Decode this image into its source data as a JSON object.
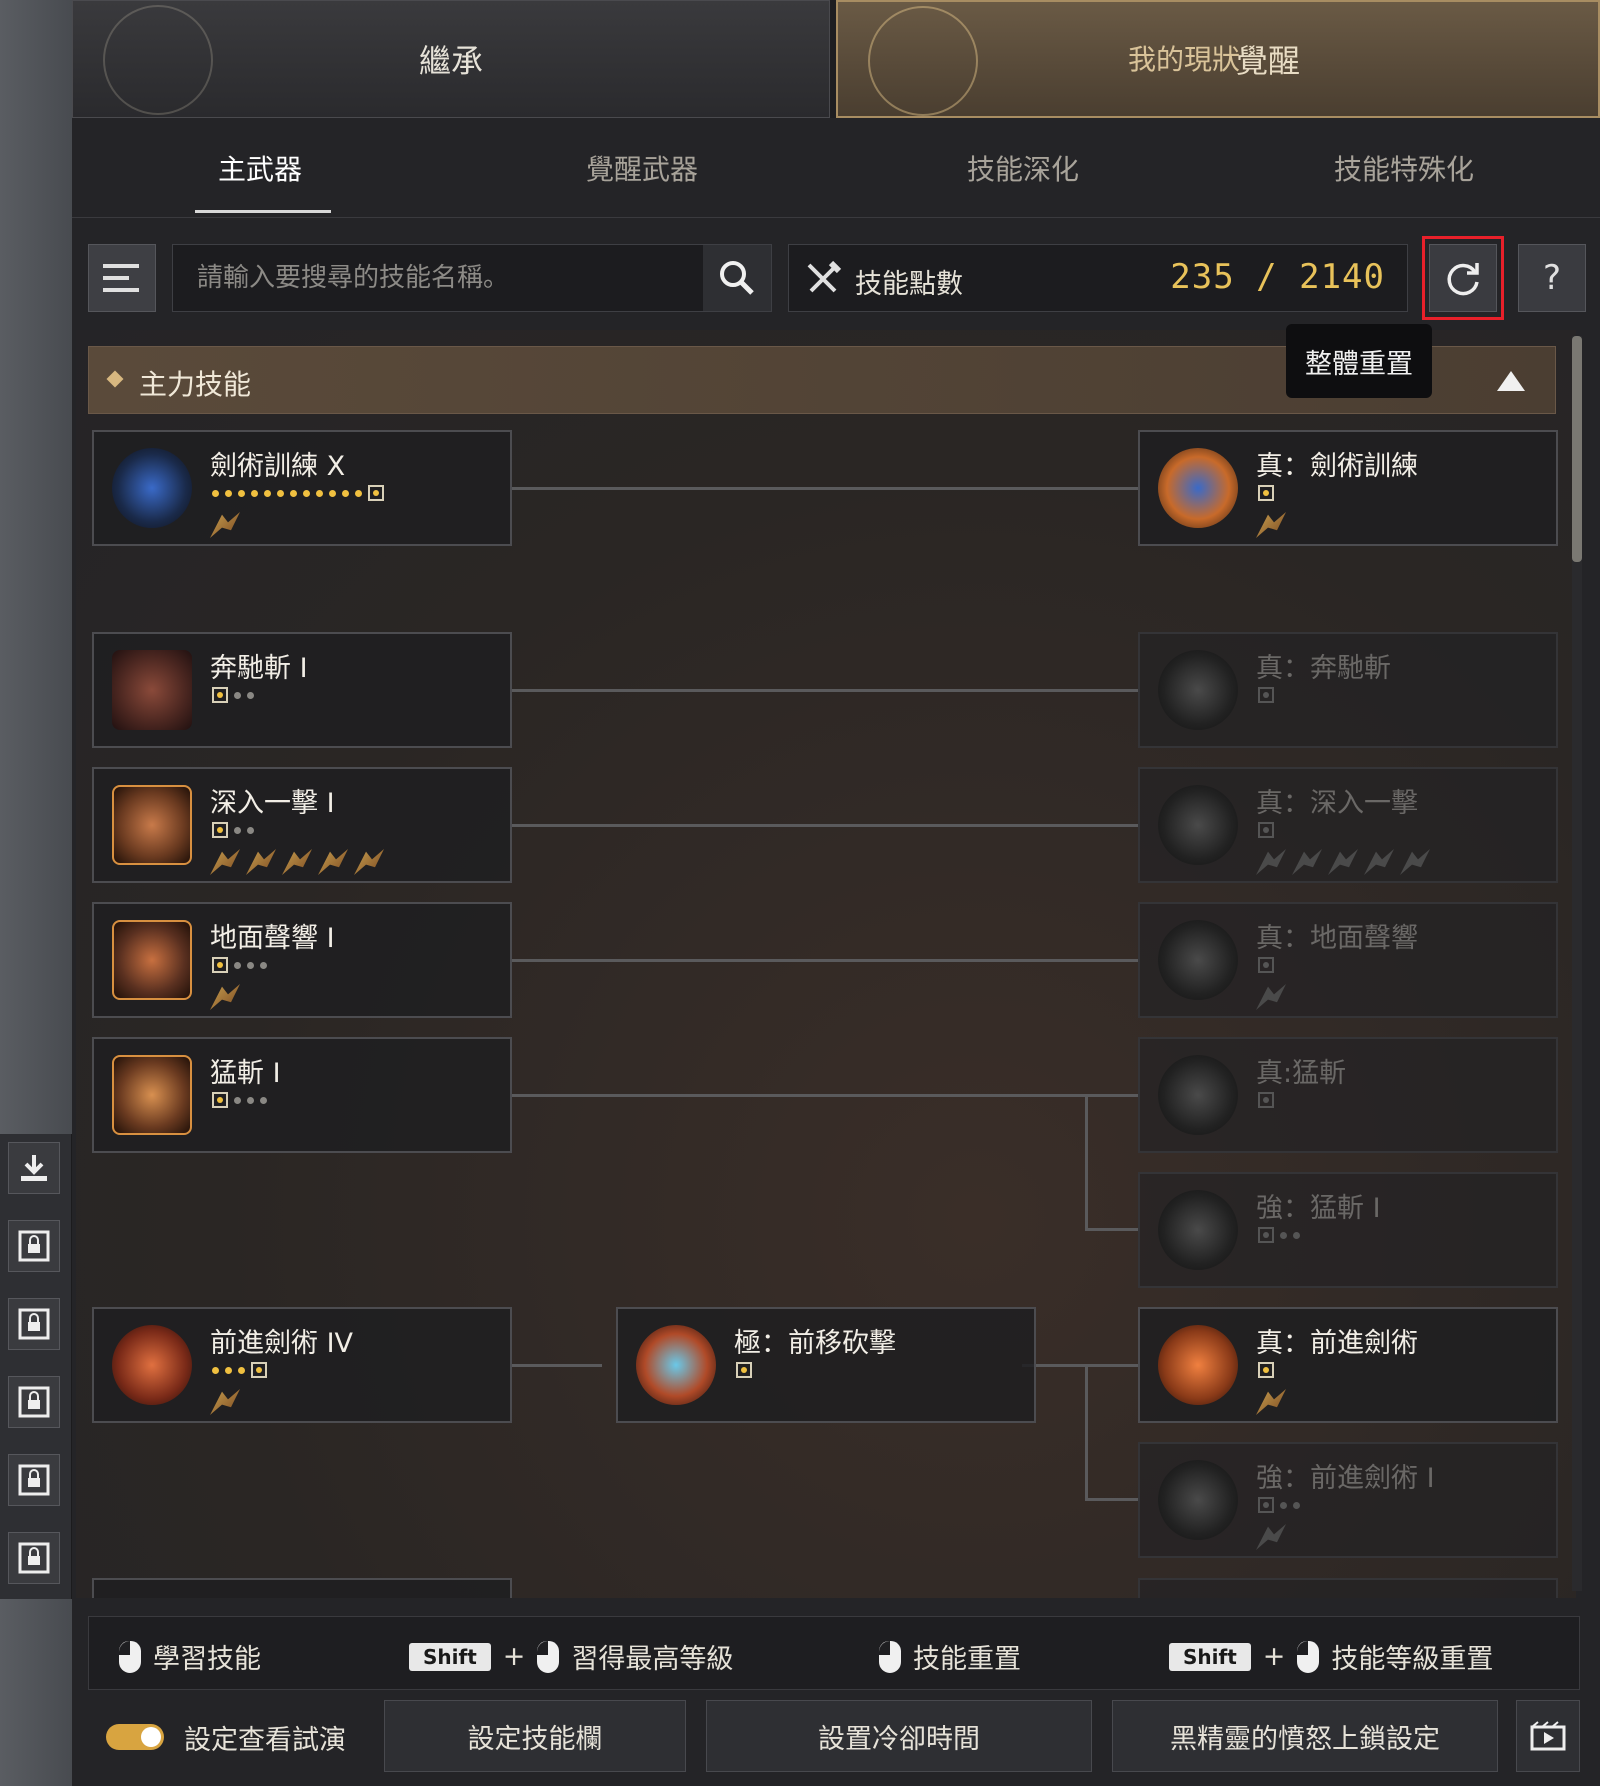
{
  "top_tabs": {
    "inherit": "繼承",
    "status": "我的現狀",
    "awaken": "覺醒"
  },
  "sub_tabs": [
    "主武器",
    "覺醒武器",
    "技能深化",
    "技能特殊化"
  ],
  "toolbar": {
    "search_placeholder": "請輸入要搜尋的技能名稱。",
    "points_label": "技能點數",
    "points_value": "235 / 2140",
    "help_label": "?",
    "reset_tooltip": "整體重置"
  },
  "section": {
    "title": "主力技能"
  },
  "skills": [
    {
      "name": "劍術訓練 X"
    },
    {
      "name": "真：劍術訓練"
    },
    {
      "name": "奔馳斬 I"
    },
    {
      "name": "真：奔馳斬"
    },
    {
      "name": "深入一擊 I"
    },
    {
      "name": "真：深入一擊"
    },
    {
      "name": "地面聲響 I"
    },
    {
      "name": "真：地面聲響"
    },
    {
      "name": "猛斬 I"
    },
    {
      "name": "真:猛斬"
    },
    {
      "name": "強：猛斬 I"
    },
    {
      "name": "前進劍術 IV"
    },
    {
      "name": "極：前移砍擊"
    },
    {
      "name": "真：前進劍術"
    },
    {
      "name": "強：前進劍術 I"
    }
  ],
  "hints": {
    "learn": "學習技能",
    "shift": "Shift",
    "plus": "+",
    "learn_max": "習得最高等級",
    "reset_skill": "技能重置",
    "reset_level": "技能等級重置"
  },
  "actions": {
    "toggle_label": "設定查看試演",
    "set_skillbar": "設定技能欄",
    "set_cooldown": "設置冷卻時間",
    "rage_lock": "黑精靈的憤怒上鎖設定"
  },
  "colors": {
    "accent_gold": "#e8c25a",
    "highlight_red": "#e8202a"
  }
}
